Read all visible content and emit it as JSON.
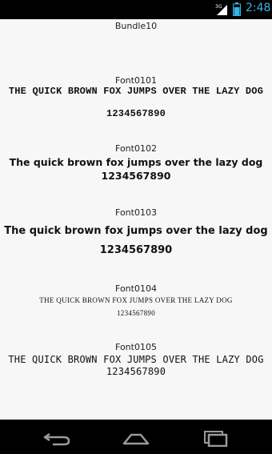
{
  "status_bar": {
    "network_label": "3G",
    "time": "2:48",
    "accent_color": "#33b5e5",
    "icons": [
      "signal-icon",
      "battery-icon"
    ]
  },
  "bundle_title": "Bundle10",
  "fonts": [
    {
      "label": "Font0101",
      "sample": "THE QUICK BROWN FOX JUMPS OVER THE LAZY DOG",
      "digits": "1234567890"
    },
    {
      "label": "Font0102",
      "sample": "The quick brown fox jumps over the lazy dog",
      "digits": "1234567890"
    },
    {
      "label": "Font0103",
      "sample": "The quick brown fox jumps over the lazy dog",
      "digits": "1234567890"
    },
    {
      "label": "Font0104",
      "sample": "THE QUICK BROWN FOX JUMPS OVER THE LAZY DOG",
      "digits": "1234567890"
    },
    {
      "label": "Font0105",
      "sample": "THE QUICK BROWN FOX JUMPS OVER THE LAZY DOG",
      "digits": "1234567890"
    }
  ],
  "nav_bar": {
    "icons": [
      "back-icon",
      "home-icon",
      "recents-icon"
    ]
  }
}
